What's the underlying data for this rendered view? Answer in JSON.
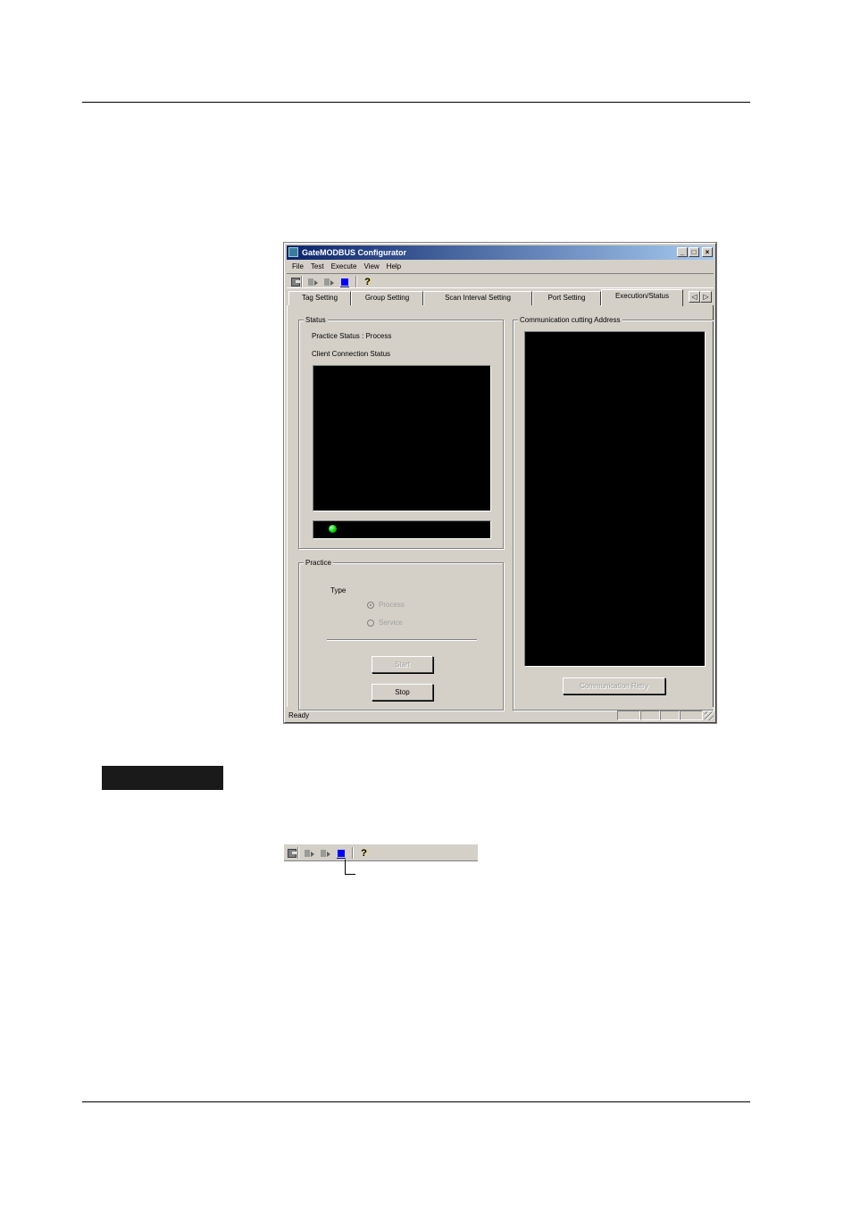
{
  "window": {
    "title": "GateMODBUS Configurator",
    "controls": {
      "minimize": "_",
      "maximize": "□",
      "close": "×"
    }
  },
  "menu": [
    "File",
    "Test",
    "Execute",
    "View",
    "Help"
  ],
  "toolbar": {
    "icons": [
      "save-icon",
      "start-execute-icon",
      "test-execute-icon",
      "stop-icon",
      "help-icon"
    ],
    "help_glyph": "?",
    "stop_color": "#0000ff"
  },
  "tabs": [
    {
      "label": "Tag Setting"
    },
    {
      "label": "Group Setting"
    },
    {
      "label": "Scan Interval Setting"
    },
    {
      "label": "Port Setting"
    },
    {
      "label": "Execution/Status",
      "active": true
    }
  ],
  "tab_scroll": {
    "left": "◁",
    "right": "▷"
  },
  "status_group": {
    "title": "Status",
    "practice_status": "Practice Status : Process",
    "client_connection_label": "Client Connection Status",
    "led_color": "#00d000"
  },
  "practice_group": {
    "title": "Practice",
    "type_title": "Type",
    "options": [
      {
        "label": "Process",
        "selected": true
      },
      {
        "label": "Service",
        "selected": false
      }
    ],
    "start_label": "Start",
    "stop_label": "Stop"
  },
  "comm_group": {
    "title": "Communication cutting Address",
    "retry_label": "Communication Retry"
  },
  "statusbar": {
    "text": "Ready"
  }
}
